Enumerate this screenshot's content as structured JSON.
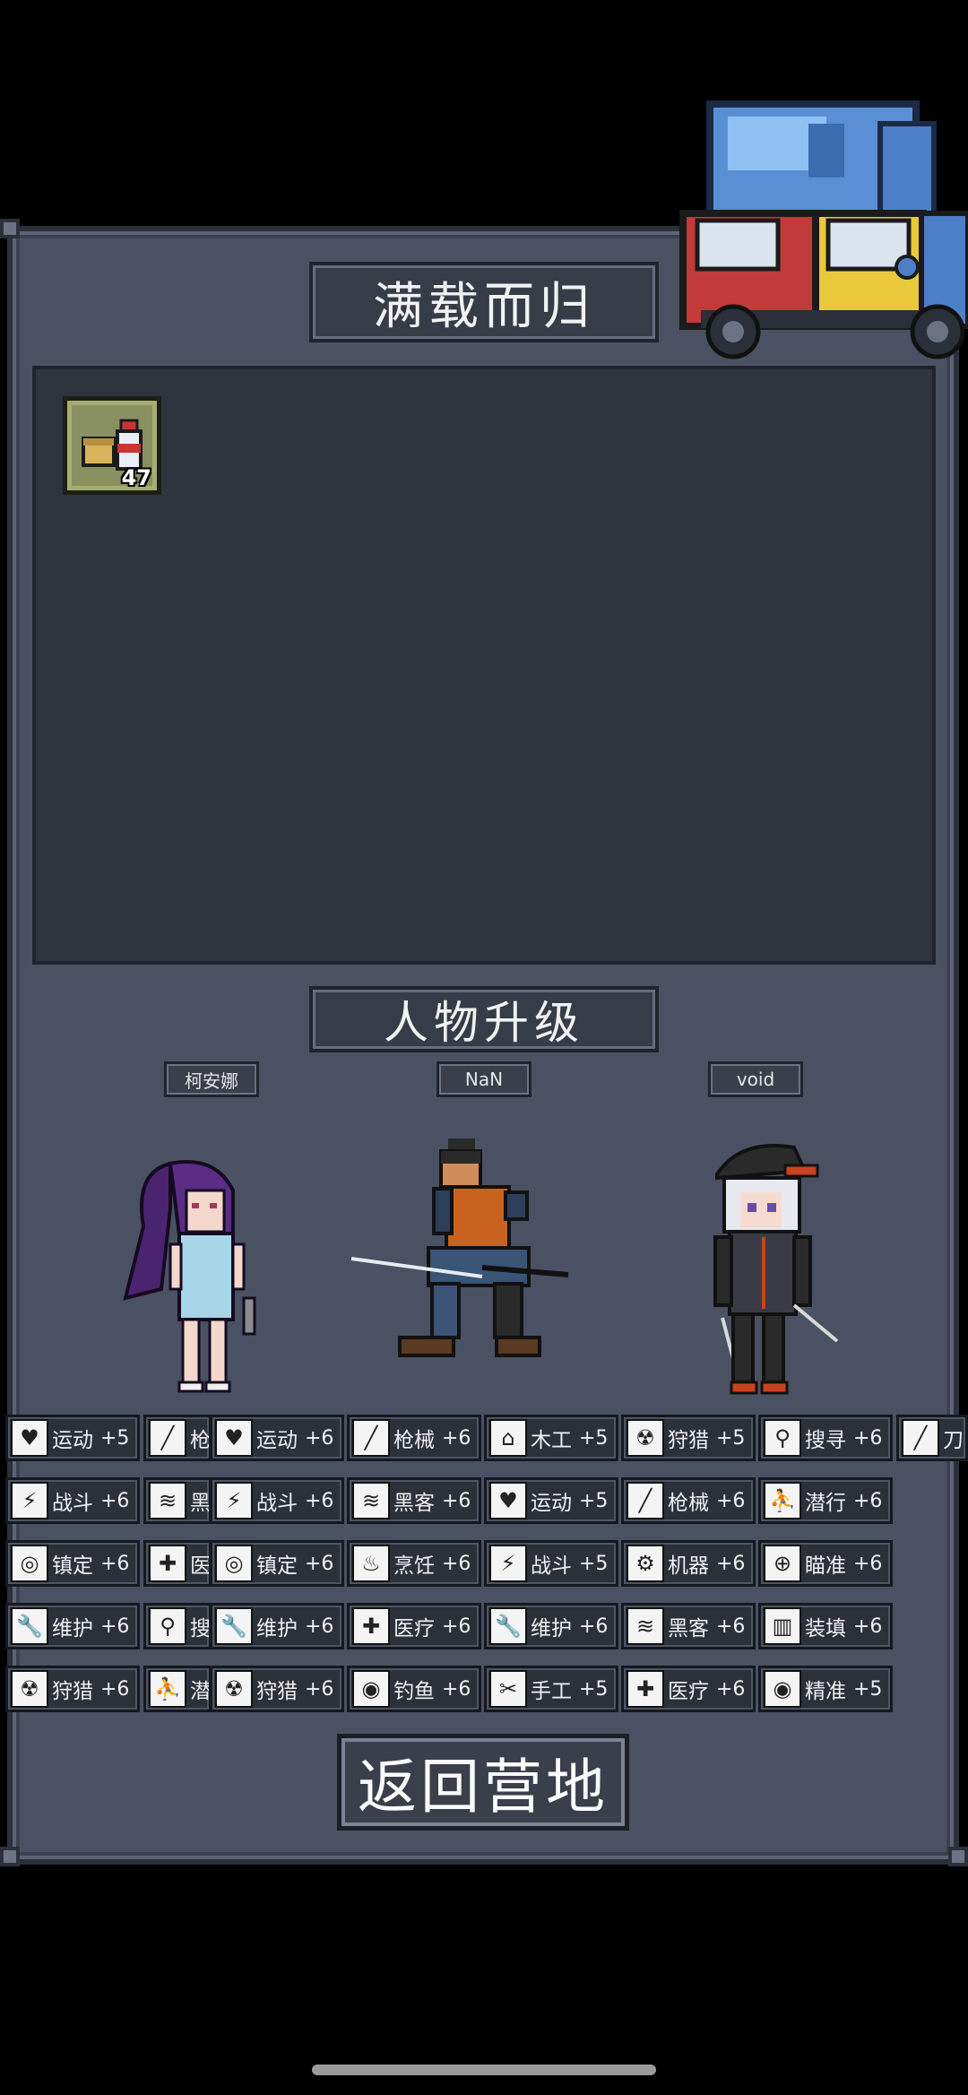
{
  "title": "满载而归",
  "upgrade_title": "人物升级",
  "loot": {
    "items": [
      {
        "icon": "canned-food-and-bottle-icon",
        "count": "47"
      }
    ]
  },
  "characters": [
    {
      "name": "柯安娜",
      "skills": [
        {
          "icon": "heart-icon",
          "label": "运动",
          "bonus": "+5"
        },
        {
          "icon": "axe-icon",
          "label": "战斗",
          "bonus": "+6"
        },
        {
          "icon": "goggles-icon",
          "label": "镇定",
          "bonus": "+6"
        },
        {
          "icon": "wrench-icon",
          "label": "维护",
          "bonus": "+6"
        },
        {
          "icon": "radiation-icon",
          "label": "狩猎",
          "bonus": "+6"
        }
      ],
      "overlap_cells": [
        {
          "icon": "gun-icon",
          "label": "枪"
        },
        {
          "icon": "circuit-icon",
          "label": "黑"
        },
        {
          "icon": "medkit-icon",
          "label": "医"
        },
        {
          "icon": "magnifier-icon",
          "label": "搜"
        },
        {
          "icon": "sneak-icon",
          "label": "潜"
        }
      ]
    },
    {
      "name": "NaN",
      "skills_col1": [
        {
          "icon": "heart-icon",
          "label": "运动",
          "bonus": "+6"
        },
        {
          "icon": "axe-icon",
          "label": "战斗",
          "bonus": "+6"
        },
        {
          "icon": "goggles-icon",
          "label": "镇定",
          "bonus": "+6"
        },
        {
          "icon": "wrench-icon",
          "label": "维护",
          "bonus": "+6"
        },
        {
          "icon": "radiation-icon",
          "label": "狩猎",
          "bonus": "+6"
        }
      ],
      "skills_col2": [
        {
          "icon": "gun-icon",
          "label": "枪械",
          "bonus": "+6"
        },
        {
          "icon": "circuit-icon",
          "label": "黑客",
          "bonus": "+6"
        },
        {
          "icon": "cooking-icon",
          "label": "烹饪",
          "bonus": "+6"
        },
        {
          "icon": "medkit-icon",
          "label": "医疗",
          "bonus": "+6"
        },
        {
          "icon": "fishing-icon",
          "label": "钓鱼",
          "bonus": "+6"
        }
      ]
    },
    {
      "name": "void",
      "skills_col1": [
        {
          "icon": "house-icon",
          "label": "木工",
          "bonus": "+5"
        },
        {
          "icon": "heart-icon",
          "label": "运动",
          "bonus": "+5"
        },
        {
          "icon": "axe-icon",
          "label": "战斗",
          "bonus": "+5"
        },
        {
          "icon": "wrench-icon",
          "label": "维护",
          "bonus": "+6"
        },
        {
          "icon": "scissors-icon",
          "label": "手工",
          "bonus": "+5"
        }
      ],
      "skills_col2": [
        {
          "icon": "radiation-icon",
          "label": "狩猎",
          "bonus": "+5"
        },
        {
          "icon": "gun-icon",
          "label": "枪械",
          "bonus": "+6"
        },
        {
          "icon": "gear-icon",
          "label": "机器",
          "bonus": "+6"
        },
        {
          "icon": "circuit-icon",
          "label": "黑客",
          "bonus": "+6"
        },
        {
          "icon": "medkit-icon",
          "label": "医疗",
          "bonus": "+6"
        }
      ],
      "skills_col3": [
        {
          "icon": "magnifier-icon",
          "label": "搜寻",
          "bonus": "+6"
        },
        {
          "icon": "sneak-icon",
          "label": "潜行",
          "bonus": "+6"
        },
        {
          "icon": "crosshair-icon",
          "label": "瞄准",
          "bonus": "+6"
        },
        {
          "icon": "ammo-icon",
          "label": "装填",
          "bonus": "+6"
        },
        {
          "icon": "eye-icon",
          "label": "精准",
          "bonus": "+5"
        }
      ],
      "overflow_cell": {
        "icon": "knife-icon",
        "label": "刀"
      }
    }
  ],
  "return_button": "返回营地",
  "colors": {
    "panel": "#4a5162",
    "dark_area": "#2f333d",
    "plate": "#373c49",
    "skill_cell": "#2c3039",
    "loot_slot": "#8a9160"
  }
}
